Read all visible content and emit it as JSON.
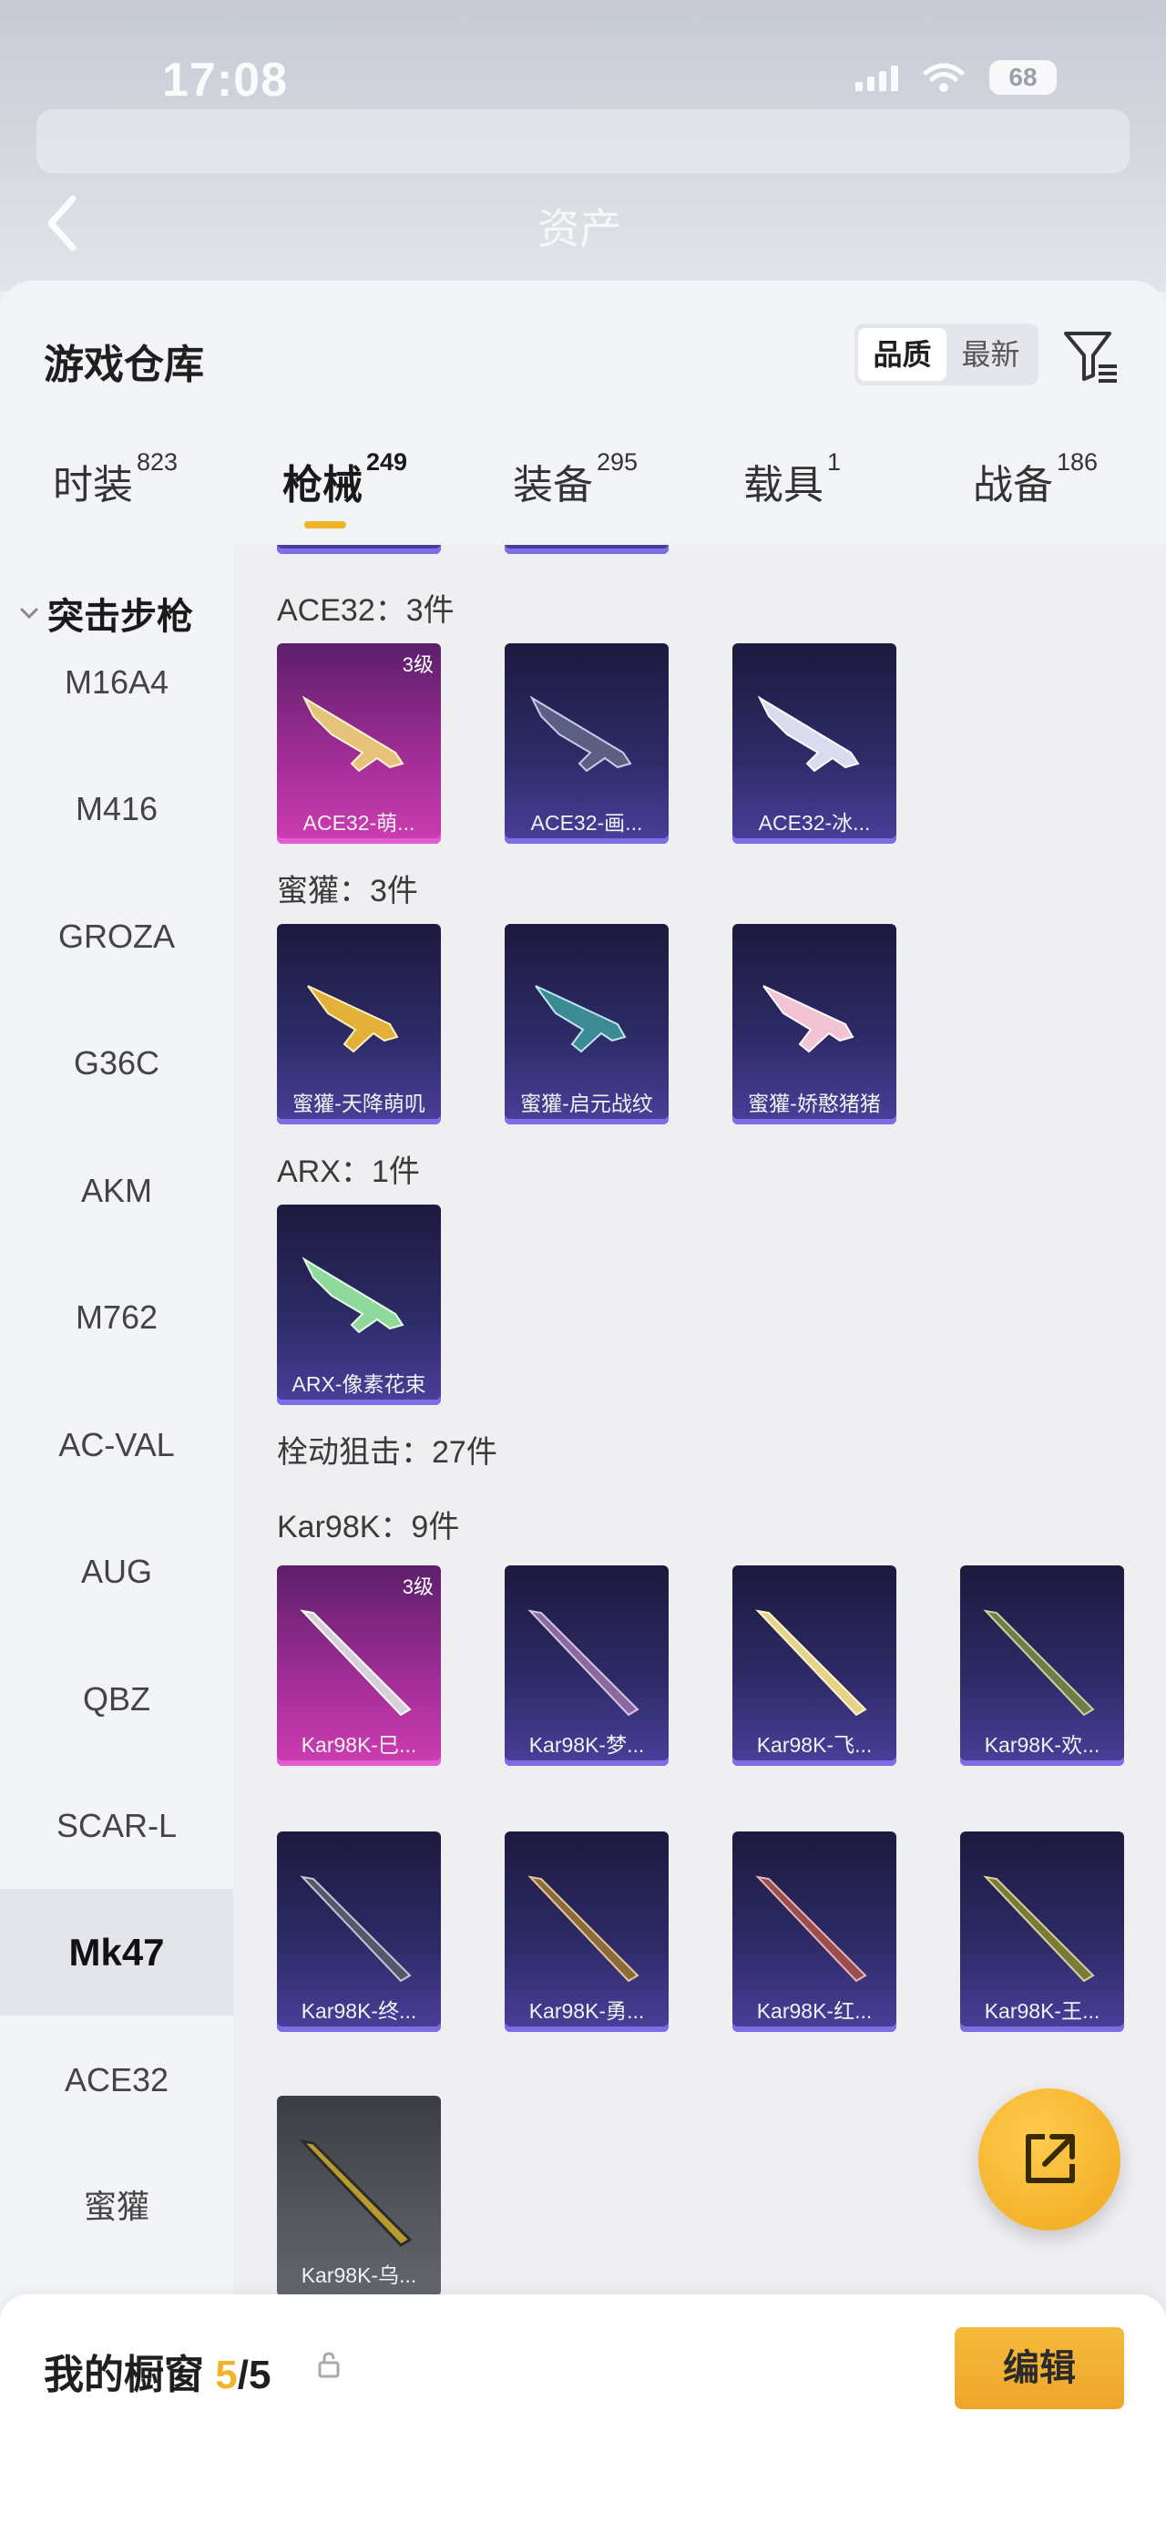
{
  "status_bar": {
    "time": "17:08",
    "battery": "68"
  },
  "header": {
    "faded_title": "资产"
  },
  "sheet": {
    "title": "游戏仓库",
    "sort_options": [
      "品质",
      "最新"
    ],
    "active_sort": "品质"
  },
  "tabs": [
    {
      "label": "时装",
      "count": "823"
    },
    {
      "label": "枪械",
      "count": "249",
      "active": true
    },
    {
      "label": "装备",
      "count": "295"
    },
    {
      "label": "载具",
      "count": "1"
    },
    {
      "label": "战备",
      "count": "186"
    }
  ],
  "sidebar": {
    "header": "突击步枪",
    "items": [
      "M16A4",
      "M416",
      "GROZA",
      "G36C",
      "AKM",
      "M762",
      "AC-VAL",
      "AUG",
      "QBZ",
      "SCAR-L",
      "Mk47",
      "ACE32",
      "蜜獾"
    ],
    "active": "Mk47"
  },
  "groups": {
    "ace32": {
      "title": "ACE32：3件",
      "items": [
        {
          "label": "ACE32-萌...",
          "level": "3级",
          "rarity": "gold"
        },
        {
          "label": "ACE32-画...",
          "rarity": "purple"
        },
        {
          "label": "ACE32-冰...",
          "rarity": "purple"
        }
      ]
    },
    "honey_badger": {
      "title": "蜜獾：3件",
      "items": [
        {
          "label": "蜜獾-天降萌叽",
          "rarity": "purple"
        },
        {
          "label": "蜜獾-启元战纹",
          "rarity": "purple"
        },
        {
          "label": "蜜獾-娇憨猪猪",
          "rarity": "purple"
        }
      ]
    },
    "arx": {
      "title": "ARX：1件",
      "items": [
        {
          "label": "ARX-像素花束",
          "rarity": "purple"
        }
      ]
    },
    "bolt_sniper": {
      "title": "栓动狙击：27件"
    },
    "kar98k": {
      "title": "Kar98K：9件",
      "items": [
        {
          "label": "Kar98K-巳...",
          "level": "3级",
          "rarity": "gold"
        },
        {
          "label": "Kar98K-梦...",
          "rarity": "purple"
        },
        {
          "label": "Kar98K-飞...",
          "rarity": "purple"
        },
        {
          "label": "Kar98K-欢...",
          "rarity": "purple"
        },
        {
          "label": "Kar98K-终...",
          "rarity": "purple"
        },
        {
          "label": "Kar98K-勇...",
          "rarity": "purple"
        },
        {
          "label": "Kar98K-红...",
          "rarity": "purple"
        },
        {
          "label": "Kar98K-王...",
          "rarity": "purple"
        },
        {
          "label": "Kar98K-乌...",
          "rarity": "grey"
        }
      ]
    }
  },
  "bottom_bar": {
    "showcase_label": "我的橱窗",
    "showcase_used": "5",
    "showcase_total": "/5",
    "edit_label": "编辑"
  },
  "colors": {
    "accent": "#f0b429",
    "card_purple": "#2d2a66",
    "card_gold": "#a52e99"
  },
  "icons": [
    "back-chevron-icon",
    "filter-icon",
    "chevron-down-icon",
    "share-icon",
    "lock-icon",
    "wifi-icon",
    "signal-icon",
    "battery-icon"
  ]
}
